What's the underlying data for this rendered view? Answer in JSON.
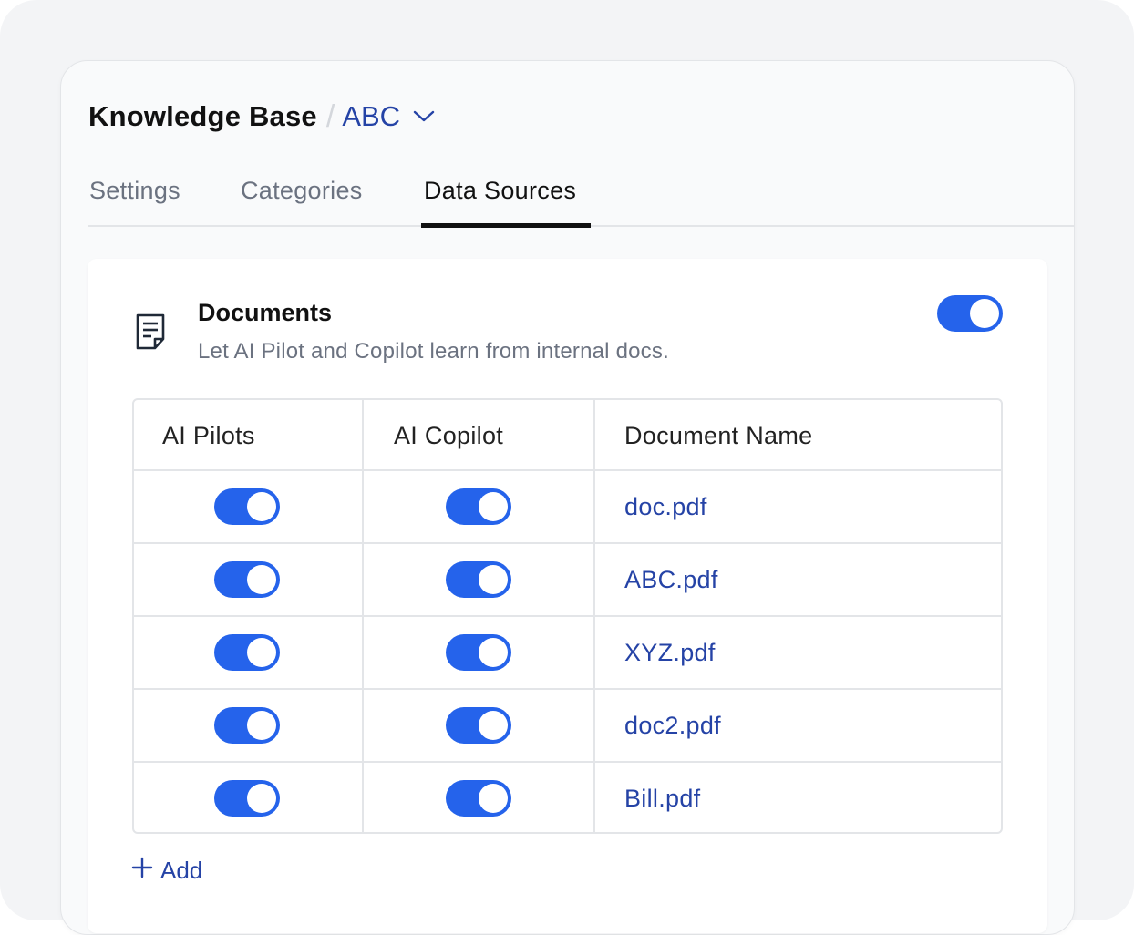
{
  "breadcrumb": {
    "root": "Knowledge Base",
    "separator": "/",
    "current": "ABC"
  },
  "tabs": [
    {
      "label": "Settings",
      "active": false
    },
    {
      "label": "Categories",
      "active": false
    },
    {
      "label": "Data Sources",
      "active": true
    }
  ],
  "section": {
    "icon": "document-icon",
    "title": "Documents",
    "description": "Let AI Pilot and Copilot learn from internal docs.",
    "enabled": true
  },
  "table": {
    "columns": [
      "AI Pilots",
      "AI Copilot",
      "Document Name"
    ],
    "rows": [
      {
        "ai_pilots": true,
        "ai_copilot": true,
        "name": "doc.pdf"
      },
      {
        "ai_pilots": true,
        "ai_copilot": true,
        "name": "ABC.pdf"
      },
      {
        "ai_pilots": true,
        "ai_copilot": true,
        "name": "XYZ.pdf"
      },
      {
        "ai_pilots": true,
        "ai_copilot": true,
        "name": "doc2.pdf"
      },
      {
        "ai_pilots": true,
        "ai_copilot": true,
        "name": "Bill.pdf"
      }
    ]
  },
  "add_label": "Add",
  "colors": {
    "accent": "#2563eb",
    "link": "#2543a6",
    "text": "#111111",
    "muted": "#6b7280",
    "border": "#e3e5e8"
  }
}
